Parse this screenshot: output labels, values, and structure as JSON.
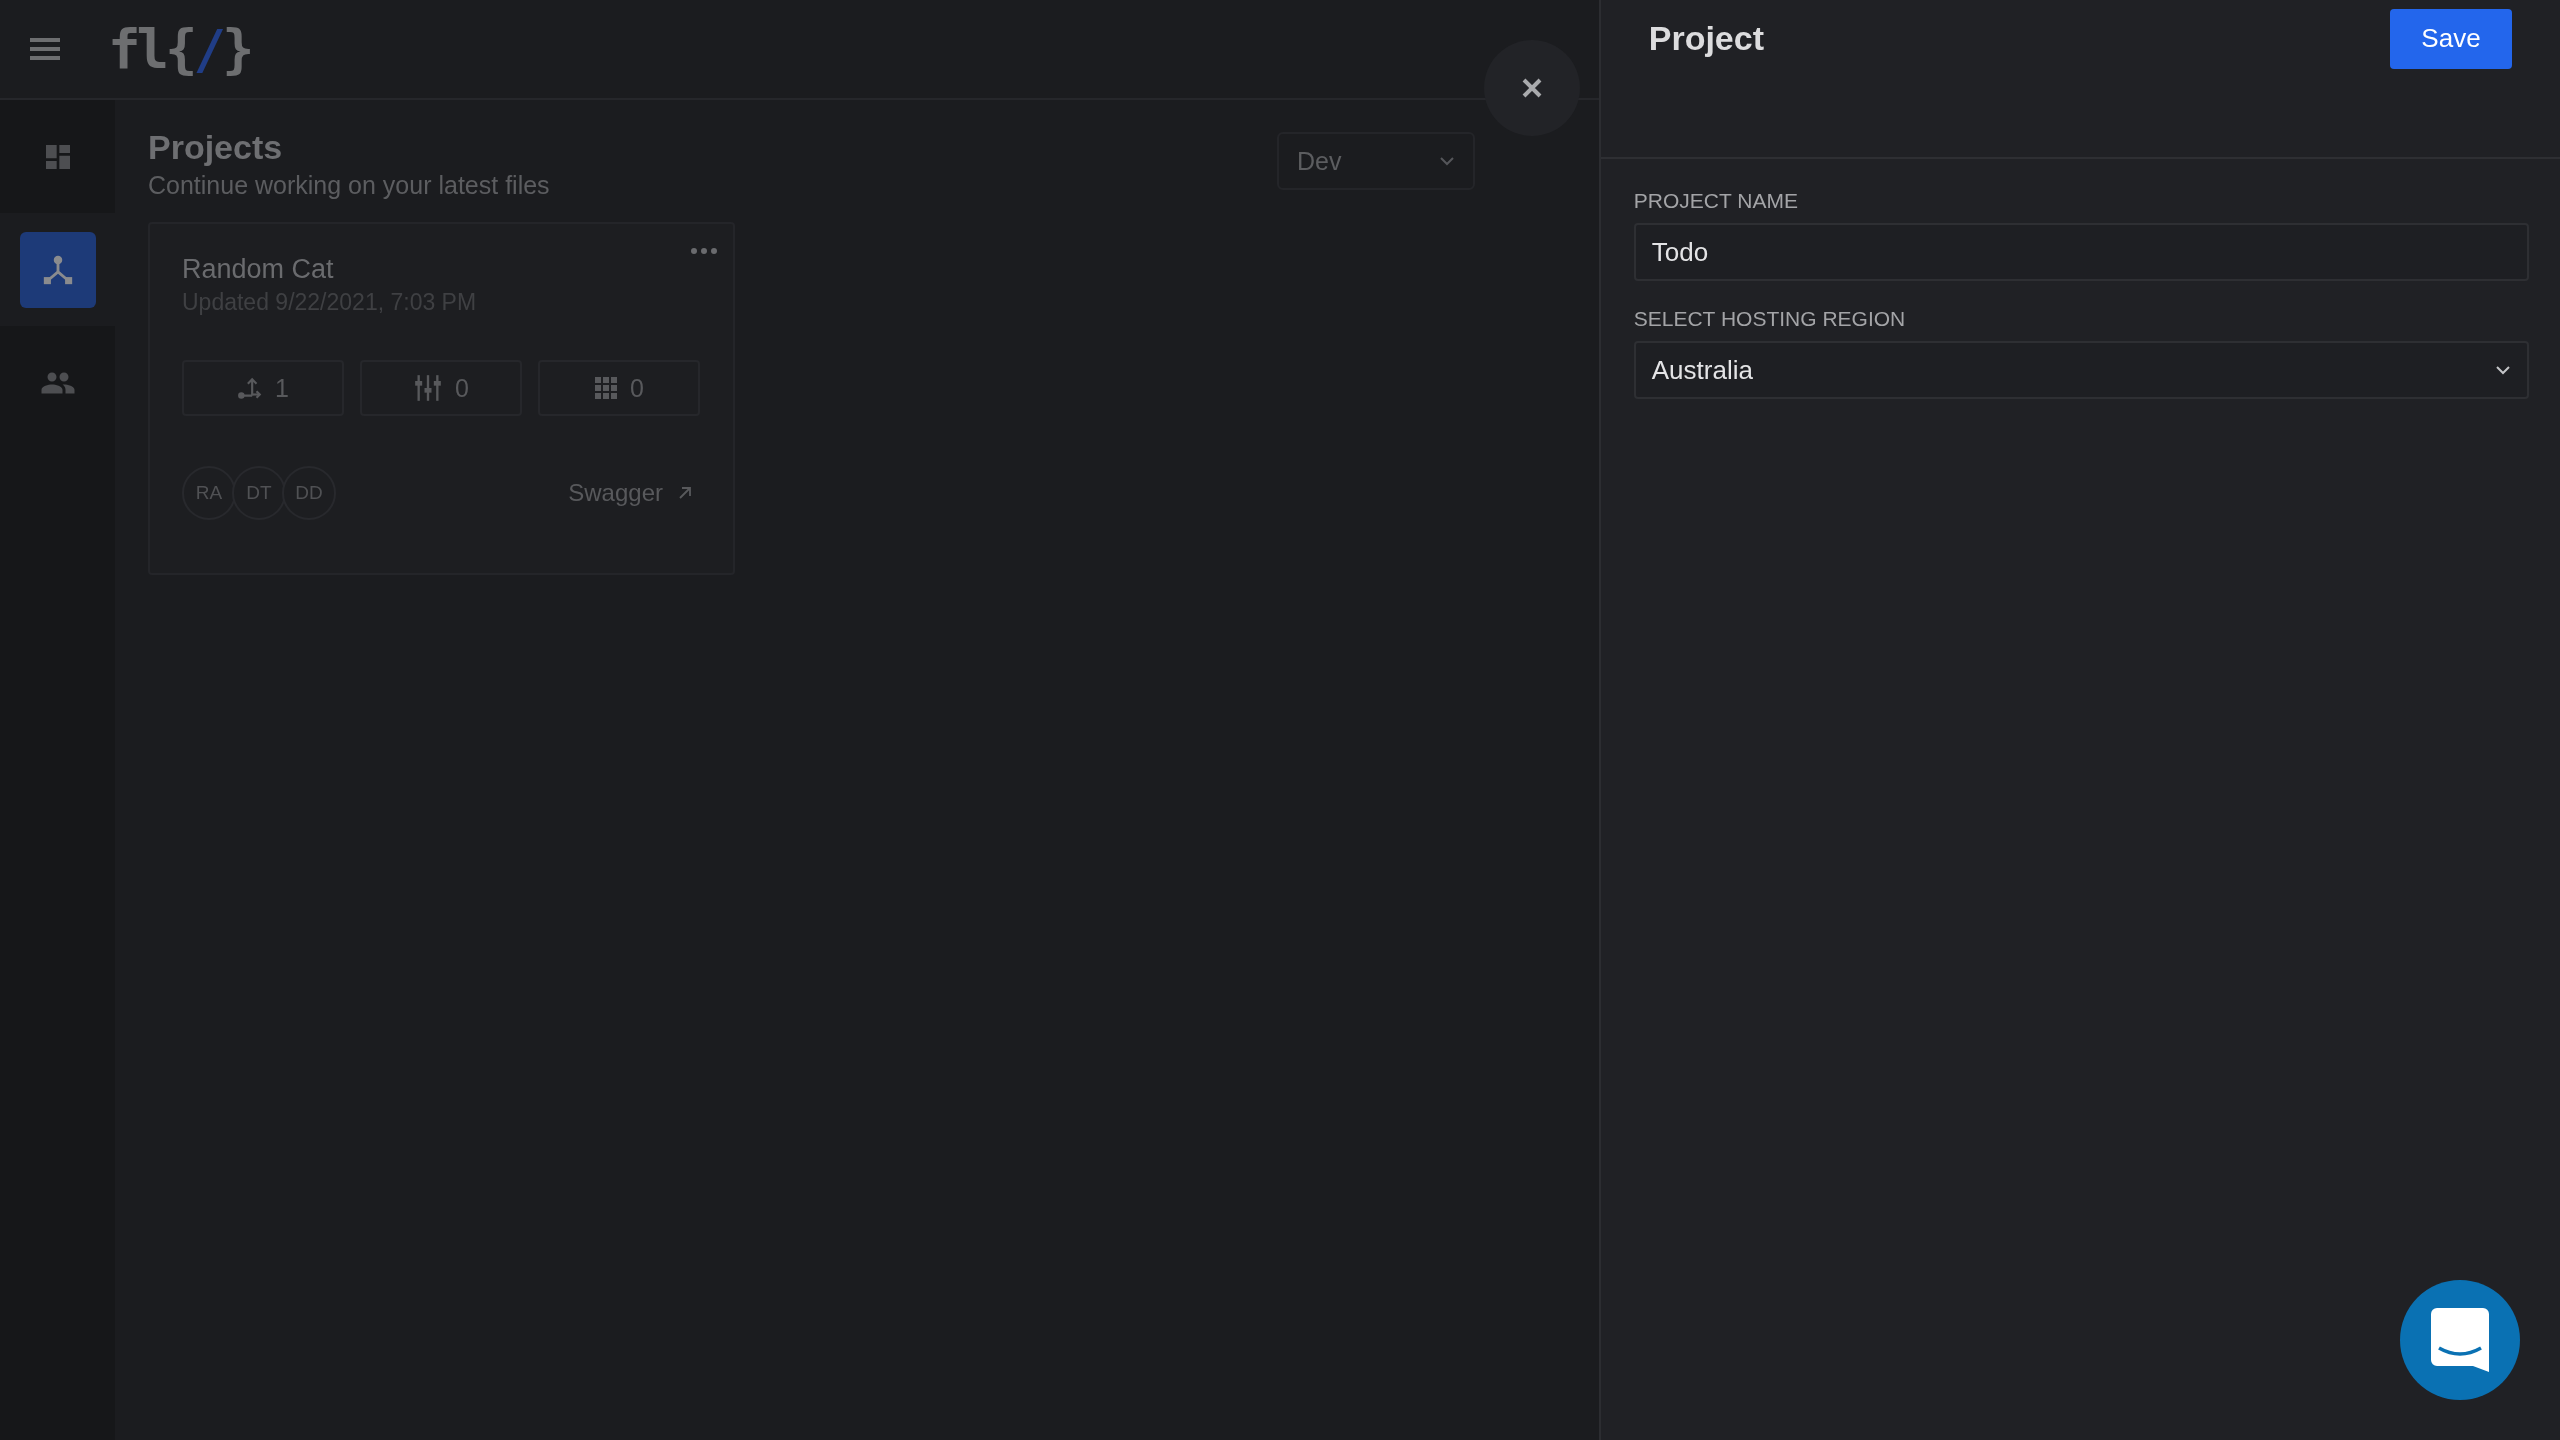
{
  "top_bar": {
    "logo": "fl{/}"
  },
  "sidebar": {
    "items": [
      {
        "kind": "dashboard",
        "selected": false
      },
      {
        "kind": "projects",
        "selected": true
      },
      {
        "kind": "team",
        "selected": false
      }
    ]
  },
  "main": {
    "title": "Projects",
    "subtitle": "Continue working on your latest files",
    "environment": "Dev",
    "cards": [
      {
        "name": "Random Cat",
        "updated": "Updated 9/22/2021, 7:03 PM",
        "stats": [
          {
            "kind": "flows",
            "value": "1"
          },
          {
            "kind": "models",
            "value": "0"
          },
          {
            "kind": "apis",
            "value": "0"
          }
        ],
        "members": [
          "RA",
          "DT",
          "DD"
        ],
        "link": "Swagger"
      }
    ]
  },
  "panel": {
    "title": "Project",
    "save": "Save",
    "fields": [
      {
        "kind": "text",
        "label": "PROJECT NAME",
        "value": "Todo"
      },
      {
        "kind": "select",
        "label": "SELECT HOSTING REGION",
        "value": "Australia"
      }
    ]
  }
}
